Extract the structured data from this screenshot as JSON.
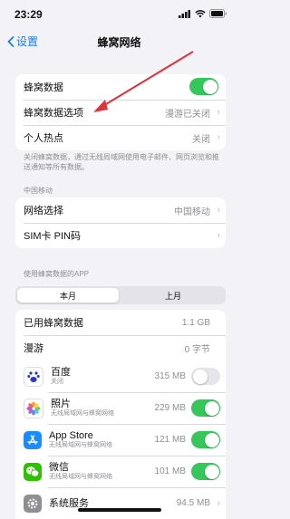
{
  "status_bar": {
    "time": "23:29"
  },
  "nav": {
    "back_label": "设置",
    "title": "蜂窝网络"
  },
  "top_group": {
    "cellular_data_label": "蜂窝数据",
    "options_label": "蜂窝数据选项",
    "options_value": "漫游已关闭",
    "hotspot_label": "个人热点",
    "hotspot_value": "关闭"
  },
  "note_text": "关闭蜂窝数据，通过无线局域网使用电子邮件、网页浏览和推送通知等所有数据。",
  "carrier": {
    "section_label": "中国移动",
    "network_label": "网络选择",
    "network_value": "中国移动",
    "sim_label": "SIM卡 PIN码"
  },
  "usage": {
    "section_label": "使用蜂窝数据的APP",
    "tab_current": "本月",
    "tab_last": "上月",
    "used_label": "已用蜂窝数据",
    "used_value": "1.1 GB",
    "roaming_label": "漫游",
    "roaming_value": "0 字节"
  },
  "apps": [
    {
      "name": "百度",
      "sub": "关闭",
      "size": "315 MB",
      "icon": "baidu-icon",
      "color": "#ffffff",
      "enabled": false
    },
    {
      "name": "照片",
      "sub": "无线局域网与蜂窝网络",
      "size": "229 MB",
      "icon": "photos-icon",
      "color": "#ffffff",
      "enabled": true
    },
    {
      "name": "App Store",
      "sub": "无线局域网与蜂窝网络",
      "size": "121 MB",
      "icon": "app-store-icon",
      "color": "#1a8cff",
      "enabled": true
    },
    {
      "name": "微信",
      "sub": "无线局域网与蜂窝网络",
      "size": "101 MB",
      "icon": "wechat-icon",
      "color": "#2dc100",
      "enabled": true
    },
    {
      "name": "系统服务",
      "sub": "",
      "size": "94.5 MB",
      "icon": "system-services-icon",
      "color": "#8e8e93",
      "enabled": null
    }
  ],
  "colors": {
    "accent": "#1a7cf5",
    "toggle_on": "#34c759",
    "arrow": "#e0323a"
  }
}
